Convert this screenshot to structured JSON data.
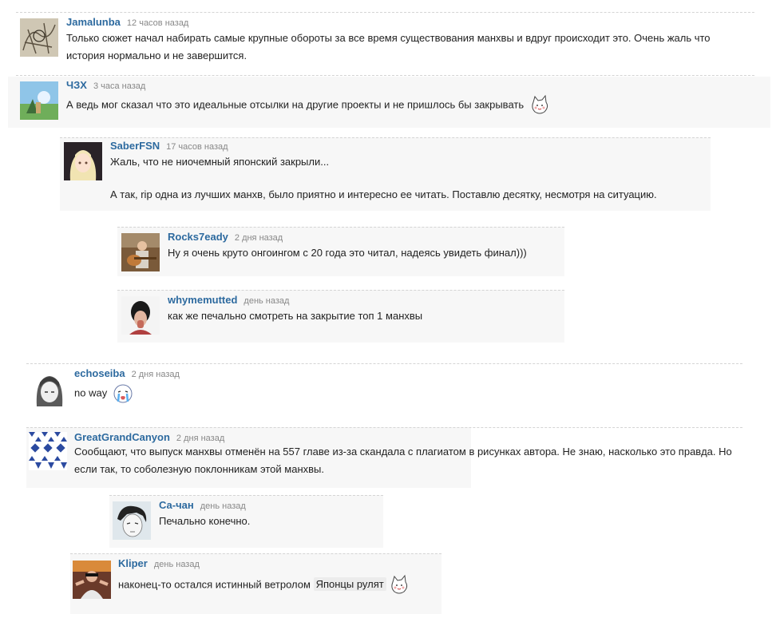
{
  "comments": [
    {
      "author": "Jamalunba",
      "time": "12 часов назад",
      "text": "Только сюжет начал набирать самые крупные обороты за все время существования манхвы и вдруг происходит это. Очень жаль что история нормально и не завершится.",
      "avatar_icon": "sketch-avatar"
    },
    {
      "author": "ЧЗХ",
      "time": "3 часа назад",
      "text": "А ведь мог сказал что это идеальные отсылки на другие проекты и не пришлось бы закрывать",
      "emote": "cat-emote",
      "avatar_icon": "landscape-avatar"
    },
    {
      "author": "SaberFSN",
      "time": "17 часов назад",
      "text": "Жаль, что не ниочемный японский закрыли...",
      "text2": "А так, rip одна из лучших манхв, было приятно и интересно ее читать. Поставлю десятку, несмотря на ситуацию.",
      "avatar_icon": "anime-girl-avatar"
    },
    {
      "author": "Rocks7eady",
      "time": "2 дня назад",
      "text": "Ну я очень круто онгоингом с 20 года это читал, надеясь увидеть финал)))",
      "avatar_icon": "guitar-avatar"
    },
    {
      "author": "whymemutted",
      "time": "день назад",
      "text": "как же печально смотреть на закрытие топ 1 манхвы",
      "avatar_icon": "person-avatar"
    },
    {
      "author": "echoseiba",
      "time": "2 дня назад",
      "text": "no way",
      "emote": "crying-emote",
      "avatar_icon": "grey-anime-avatar"
    },
    {
      "author": "GreatGrandCanyon",
      "time": "2 дня назад",
      "text": "Сообщают, что выпуск манхвы отменён на 557 главе из-за скандала с плагиатом в рисунках автора. Не знаю, насколько это правда. Но если так, то соболезную поклонникам этой манхвы.",
      "avatar_icon": "pattern-avatar"
    },
    {
      "author": "Са-чан",
      "time": "день назад",
      "text": "Печально конечно.",
      "avatar_icon": "manga-boy-avatar"
    },
    {
      "author": "Kliper",
      "time": "день назад",
      "text": "наконец-то остался истинный ветролом",
      "spoiler": "Японцы рулят",
      "emote": "cat-emote",
      "avatar_icon": "photo-avatar"
    }
  ]
}
